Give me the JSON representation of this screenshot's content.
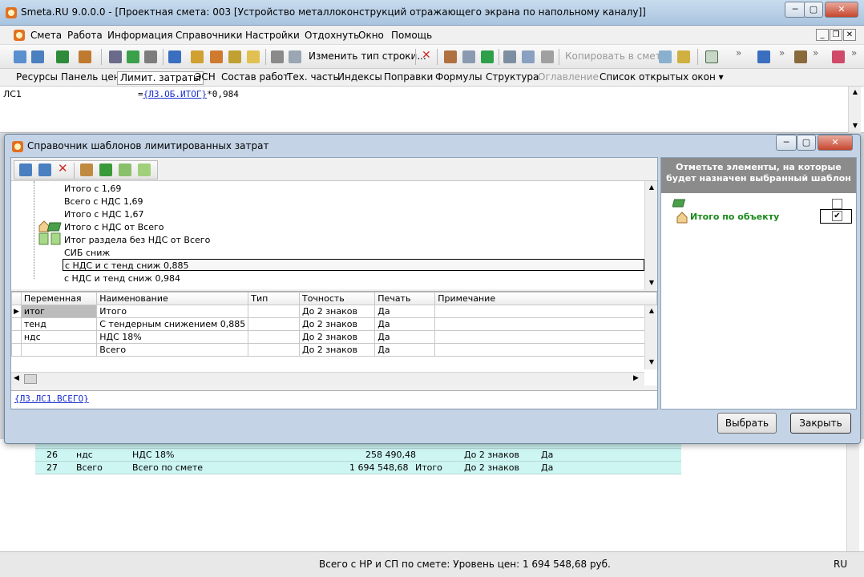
{
  "window": {
    "title": "Smeta.RU  9.0.0.0   - [Проектная смета: 003 [Устройство металлоконструкций отражающего экрана по напольному каналу]]",
    "minimize": "─",
    "maximize": "▢",
    "close": "✕"
  },
  "menu": {
    "items": [
      "Смета",
      "Работа",
      "Информация",
      "Справочники",
      "Настройки",
      "Отдохнуть",
      "Окно",
      "Помощь"
    ],
    "mdi_min": "_",
    "mdi_restore": "❐",
    "mdi_close": "✕"
  },
  "toolbar": {
    "change_row_type": "Изменить тип строки...",
    "copy_to_estimate": "Копировать в смету",
    "overflow": "»"
  },
  "tabs": {
    "items": [
      "Ресурсы",
      "Панель цен",
      "Лимит. затраты",
      "ЭСН",
      "Состав работ",
      "Тех. часть",
      "Индексы",
      "Поправки",
      "Формулы",
      "Структура",
      "Оглавление",
      "Список открытых окон ▾"
    ],
    "active_index": 2,
    "disabled_index": 10
  },
  "formula_bar": {
    "cell_name": "ЛС1",
    "formula_prefix": "=",
    "formula_link": "{ЛЗ.ОБ.ИТОГ}",
    "formula_suffix": "*0,984"
  },
  "background_rows": [
    {
      "num": "26",
      "var": "ндс",
      "name": "НДС 18%",
      "value": "258 490,48",
      "type": "",
      "precision": "До 2 знаков",
      "print": "Да"
    },
    {
      "num": "27",
      "var": "Всего",
      "name": "Всего по смете",
      "value": "1 694 548,68",
      "type": "Итого",
      "precision": "До 2 знаков",
      "print": "Да"
    }
  ],
  "status_bar": {
    "text": "Всего с НР и СП по смете: Уровень цен: 1 694 548,68 руб.",
    "lang": "RU"
  },
  "dialog": {
    "title": "Справочник шаблонов лимитированных затрат",
    "tree_items": [
      {
        "label": "Итого с 1,69",
        "icon": "none"
      },
      {
        "label": "Всего с НДС 1,69",
        "icon": "none"
      },
      {
        "label": "Итого с НДС 1,67",
        "icon": "none"
      },
      {
        "label": "Итого с НДС от Всего",
        "icon": "house-book-icon"
      },
      {
        "label": "Итог раздела без НДС от Всего",
        "icon": "pages-icon"
      },
      {
        "label": "СИБ сниж",
        "icon": "none"
      },
      {
        "label": "с НДС и с тенд сниж 0,885",
        "icon": "none",
        "selected": true
      },
      {
        "label": "с НДС и тенд сниж 0,984",
        "icon": "none"
      }
    ],
    "grid": {
      "headers": [
        "Переменная",
        "Наименование",
        "Тип",
        "Точность",
        "Печать",
        "Примечание"
      ],
      "rows": [
        [
          "итог",
          "Итого",
          "",
          "До 2 знаков",
          "Да",
          ""
        ],
        [
          "тенд",
          "С тендерным снижением 0,885",
          "",
          "До 2 знаков",
          "Да",
          ""
        ],
        [
          "ндс",
          "НДС 18%",
          "",
          "До 2 знаков",
          "Да",
          ""
        ],
        [
          "",
          "Всего",
          "",
          "До 2 знаков",
          "Да",
          ""
        ]
      ]
    },
    "formula": "{ЛЗ.ЛС1.ВСЕГО}",
    "right_panel": {
      "header": "Отметьте элементы, на которые будет назначен выбранный шаблон",
      "item_label": "Итого по объекту"
    },
    "buttons": {
      "select": "Выбрать",
      "close": "Закрыть"
    }
  }
}
